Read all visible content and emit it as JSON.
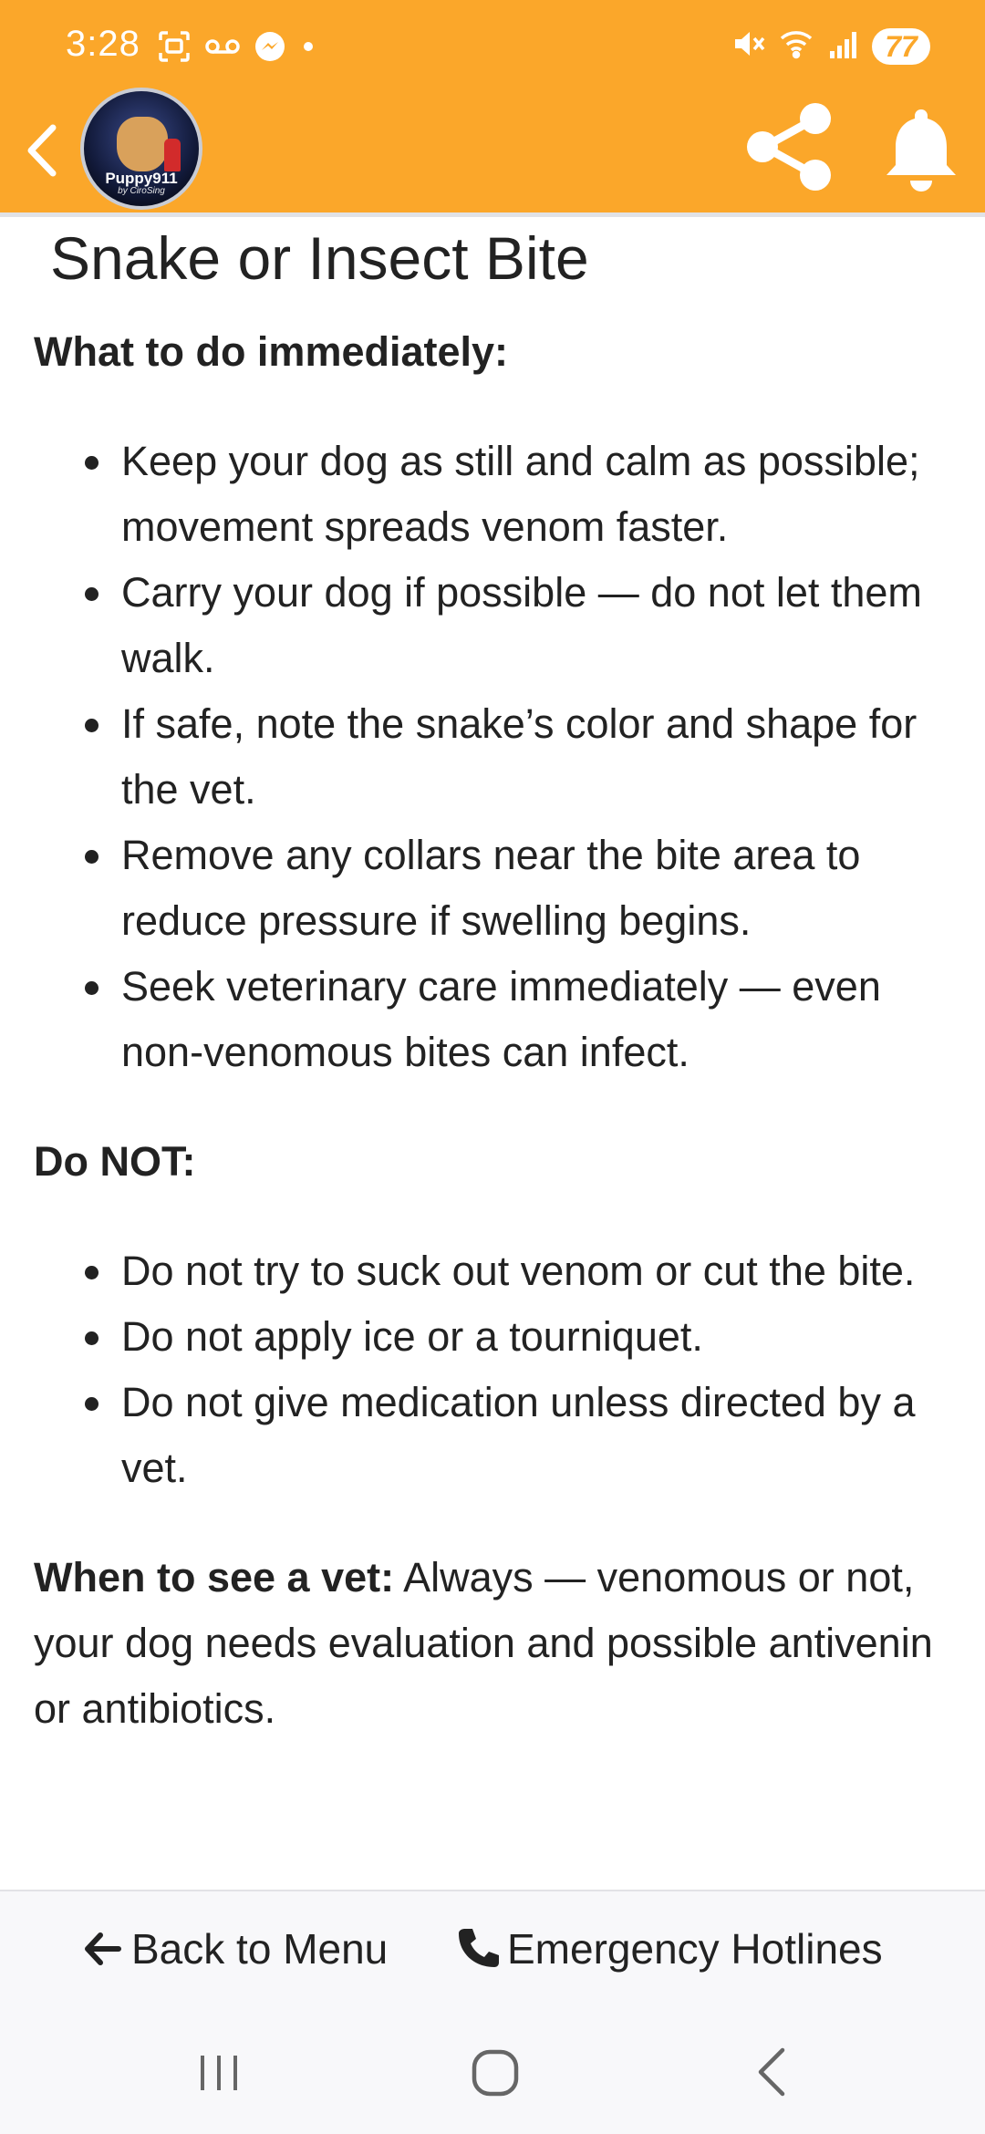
{
  "status_bar": {
    "time": "3:28",
    "battery": "77",
    "left_icons": [
      "screenshot-icon",
      "voicemail-icon",
      "messenger-icon",
      "dot-icon"
    ],
    "right_icons": [
      "mute-icon",
      "wifi-icon",
      "signal-icon"
    ]
  },
  "app_bar": {
    "logo_text": "Puppy911",
    "logo_subtext": "by CiroSing",
    "background_color": "#FBA72A",
    "icons": [
      "back-chevron-icon",
      "share-icon",
      "bell-icon"
    ]
  },
  "article": {
    "title": "Snake or Insect Bite",
    "immediate_heading": "What to do immediately:",
    "immediate_items": [
      "Keep your dog as still and calm as possible; movement spreads venom faster.",
      "Carry your dog if possible — do not let them walk.",
      "If safe, note the snake’s color and shape for the vet.",
      "Remove any collars near the bite area to reduce pressure if swelling begins.",
      "Seek veterinary care immediately — even non-venomous bites can infect."
    ],
    "donot_heading": "Do NOT:",
    "donot_items": [
      "Do not try to suck out venom or cut the bite.",
      "Do not apply ice or a tourniquet.",
      "Do not give medication unless directed by a vet."
    ],
    "vet_label": "When to see a vet:",
    "vet_text": " Always — venomous or not, your dog needs evaluation and possible antivenin or antibiotics."
  },
  "bottom_bar": {
    "back_label": "Back to Menu",
    "emergency_label": "Emergency Hotlines"
  }
}
